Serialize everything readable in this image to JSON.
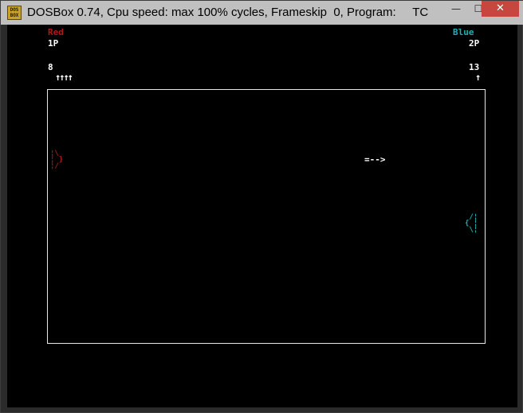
{
  "window": {
    "title": "DOSBox 0.74, Cpu speed: max 100% cycles, Frameskip  0, Program:     TC",
    "icon_text": "DOS\nBOX",
    "icon": "dosbox-icon",
    "minimize_glyph": "—",
    "maximize_glyph": "☐",
    "close_glyph": "✕"
  },
  "game": {
    "player1": {
      "name": "Red",
      "label": "1P",
      "score": "8",
      "ammo": "↑↑↑↑",
      "color": "#b21818"
    },
    "player2": {
      "name": "Blue",
      "label": "2P",
      "score": "13",
      "ammo": "↑",
      "color": "#18b2b2"
    },
    "projectile": "=-->",
    "red_tank": "¦\\\n¦ }\n¦/",
    "blue_tank": " /¦\n{ ¦\n \\¦"
  },
  "colors": {
    "background": "#000000",
    "arena_border": "#e8e8e8",
    "text": "#ffffff"
  }
}
